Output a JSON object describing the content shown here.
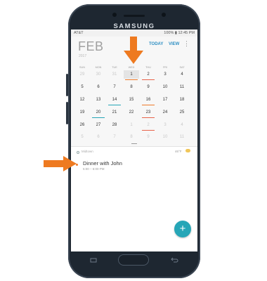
{
  "device": {
    "brand": "SAMSUNG"
  },
  "status_bar": {
    "carrier": "AT&T",
    "right_text": "100% ▮ 12:45 PM"
  },
  "header": {
    "month": "FEB",
    "year": "2017",
    "today_label": "TODAY",
    "view_label": "VIEW",
    "more_label": "⋮"
  },
  "calendar": {
    "weekdays": [
      "SUN",
      "MON",
      "TUE",
      "WED",
      "THU",
      "FRI",
      "SAT"
    ],
    "weeks": [
      [
        "29",
        "30",
        "31",
        "1",
        "2",
        "3",
        "4"
      ],
      [
        "5",
        "6",
        "7",
        "8",
        "9",
        "10",
        "11"
      ],
      [
        "12",
        "13",
        "14",
        "15",
        "16",
        "17",
        "18"
      ],
      [
        "19",
        "20",
        "21",
        "22",
        "23",
        "24",
        "25"
      ],
      [
        "26",
        "27",
        "28",
        "1",
        "2",
        "3",
        "4"
      ],
      [
        "5",
        "6",
        "7",
        "8",
        "9",
        "10",
        "11"
      ]
    ],
    "selected_day": "1",
    "accent_orange": "#ee7a2a",
    "accent_teal": "#26a6b7",
    "accent_red": "#e8634a"
  },
  "events_panel": {
    "location": "Midtown",
    "weather": "46°F",
    "events": [
      {
        "title": "Dinner with John",
        "time": "5:00 – 6:00 PM"
      }
    ]
  },
  "fab_label": "+",
  "callout_color": "#ee7a20"
}
